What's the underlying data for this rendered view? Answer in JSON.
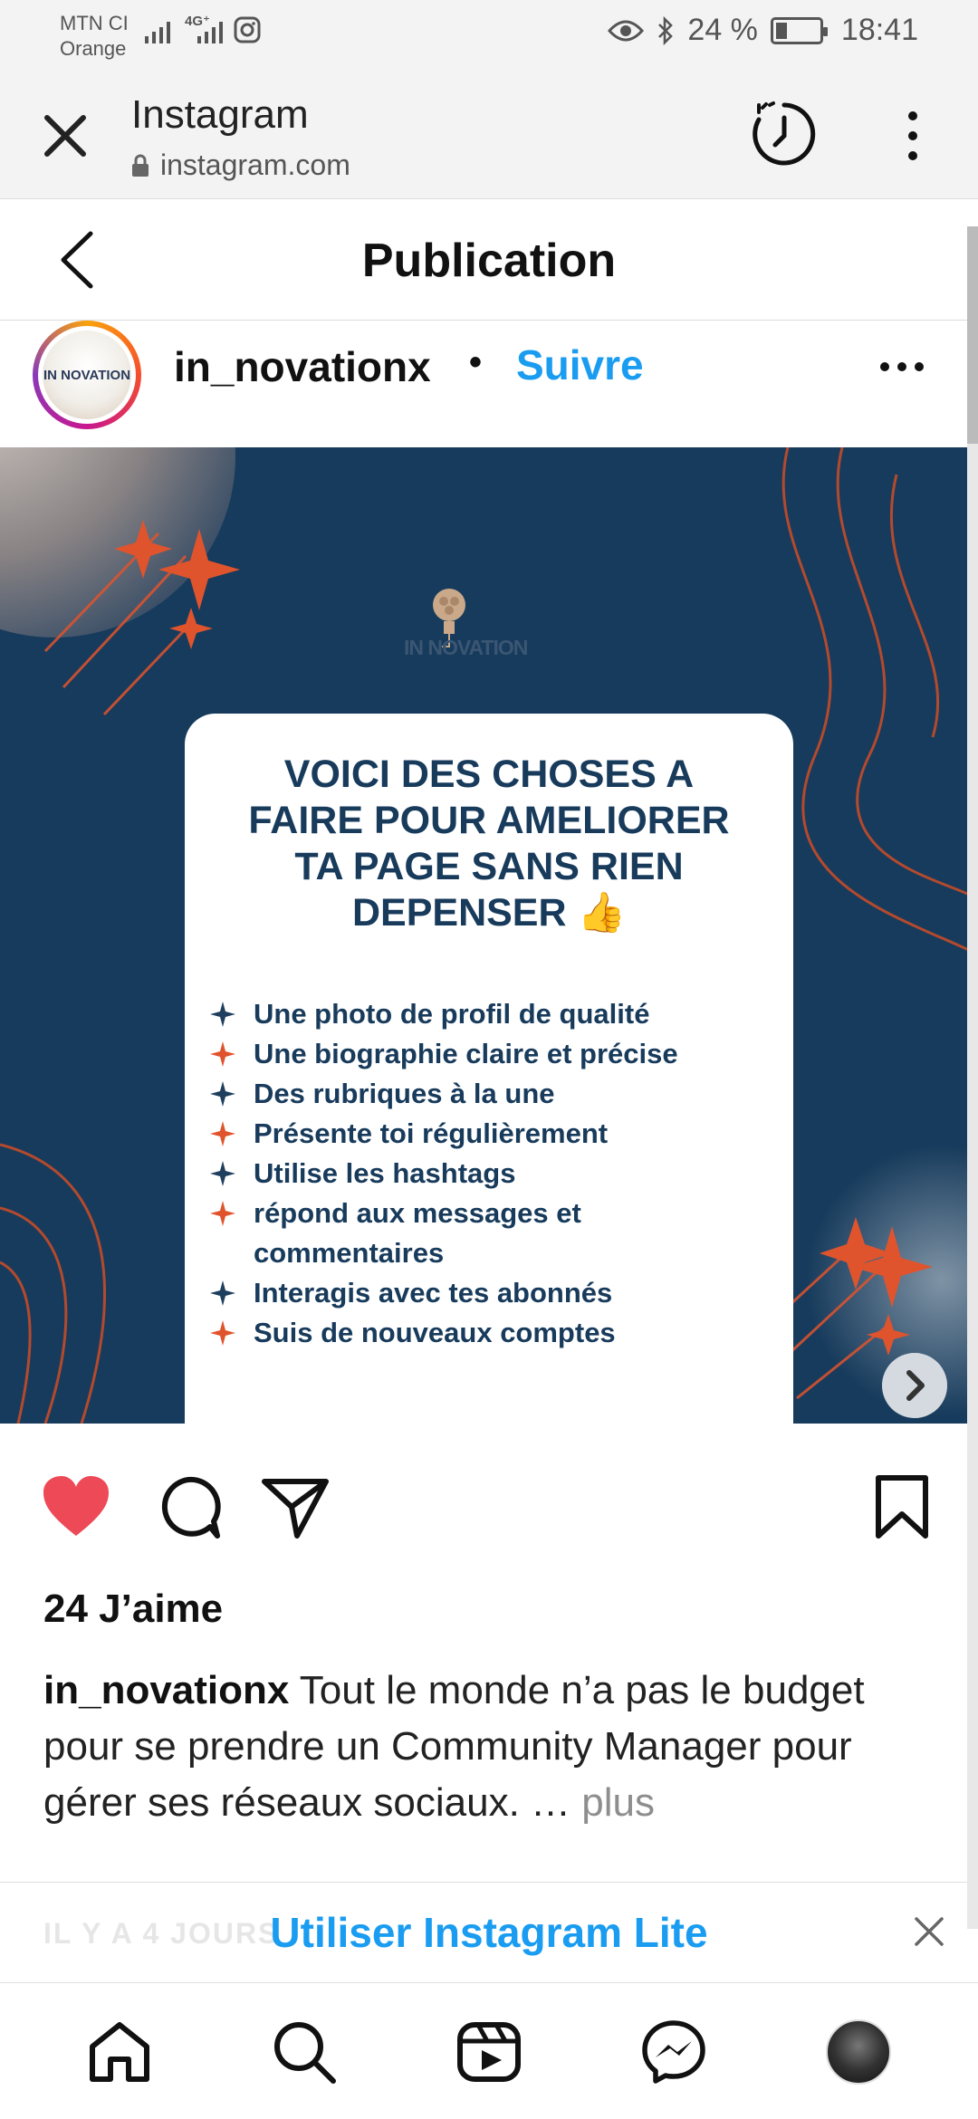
{
  "status_bar": {
    "carrier_line1": "MTN CI",
    "carrier_line2": "Orange",
    "network_label": "4G⁺",
    "battery_text": "24 %",
    "battery_level_percent": 24,
    "time": "18:41"
  },
  "browser": {
    "title": "Instagram",
    "url": "instagram.com"
  },
  "header": {
    "title": "Publication"
  },
  "post": {
    "username": "in_novationx",
    "separator": "•",
    "follow_label": "Suivre",
    "avatar_text": "IN NOVATION",
    "image": {
      "logo_text": "IN NOVATION",
      "title_lines": [
        "VOICI DES CHOSES A",
        "FAIRE POUR AMELIORER",
        "TA PAGE SANS RIEN",
        "DEPENSER 👍"
      ],
      "checklist": [
        "Une photo de profil de qualité",
        "Une biographie claire et précise",
        "Des rubriques à la une",
        "Présente toi régulièrement",
        "Utilise les hashtags",
        "répond aux messages et",
        "commentaires",
        "Interagis avec tes abonnés",
        "Suis de nouveaux comptes"
      ],
      "star_colors": [
        "#1f3f5f",
        "#e0542d",
        "#1f3f5f",
        "#e0542d",
        "#1f3f5f",
        "#e0542d",
        "",
        "#1f3f5f",
        "#e0542d"
      ]
    },
    "liked": true,
    "likes_text": "24 J’aime",
    "caption_user": "in_novationx",
    "caption_text": " Tout le monde n’a pas le budget pour se prendre un Community Manager pour gérer ses réseaux sociaux. … ",
    "caption_more": "plus",
    "timestamp_faded": "IL Y A 4 JOURS"
  },
  "banner": {
    "label": "Utiliser Instagram Lite"
  },
  "icons": {
    "close": "close-icon",
    "lock": "lock-icon",
    "timer": "timer-icon",
    "more": "more-vertical-icon",
    "back": "back-chevron-icon",
    "heart": "heart-icon",
    "comment": "comment-icon",
    "share": "send-icon",
    "bookmark": "bookmark-icon",
    "home": "home-icon",
    "search": "search-icon",
    "reels": "reels-icon",
    "messenger": "messenger-icon"
  },
  "colors": {
    "accent_blue": "#1a9cf0",
    "like_red": "#ed4956",
    "post_bg": "#173b5c",
    "orange": "#e0542d"
  }
}
